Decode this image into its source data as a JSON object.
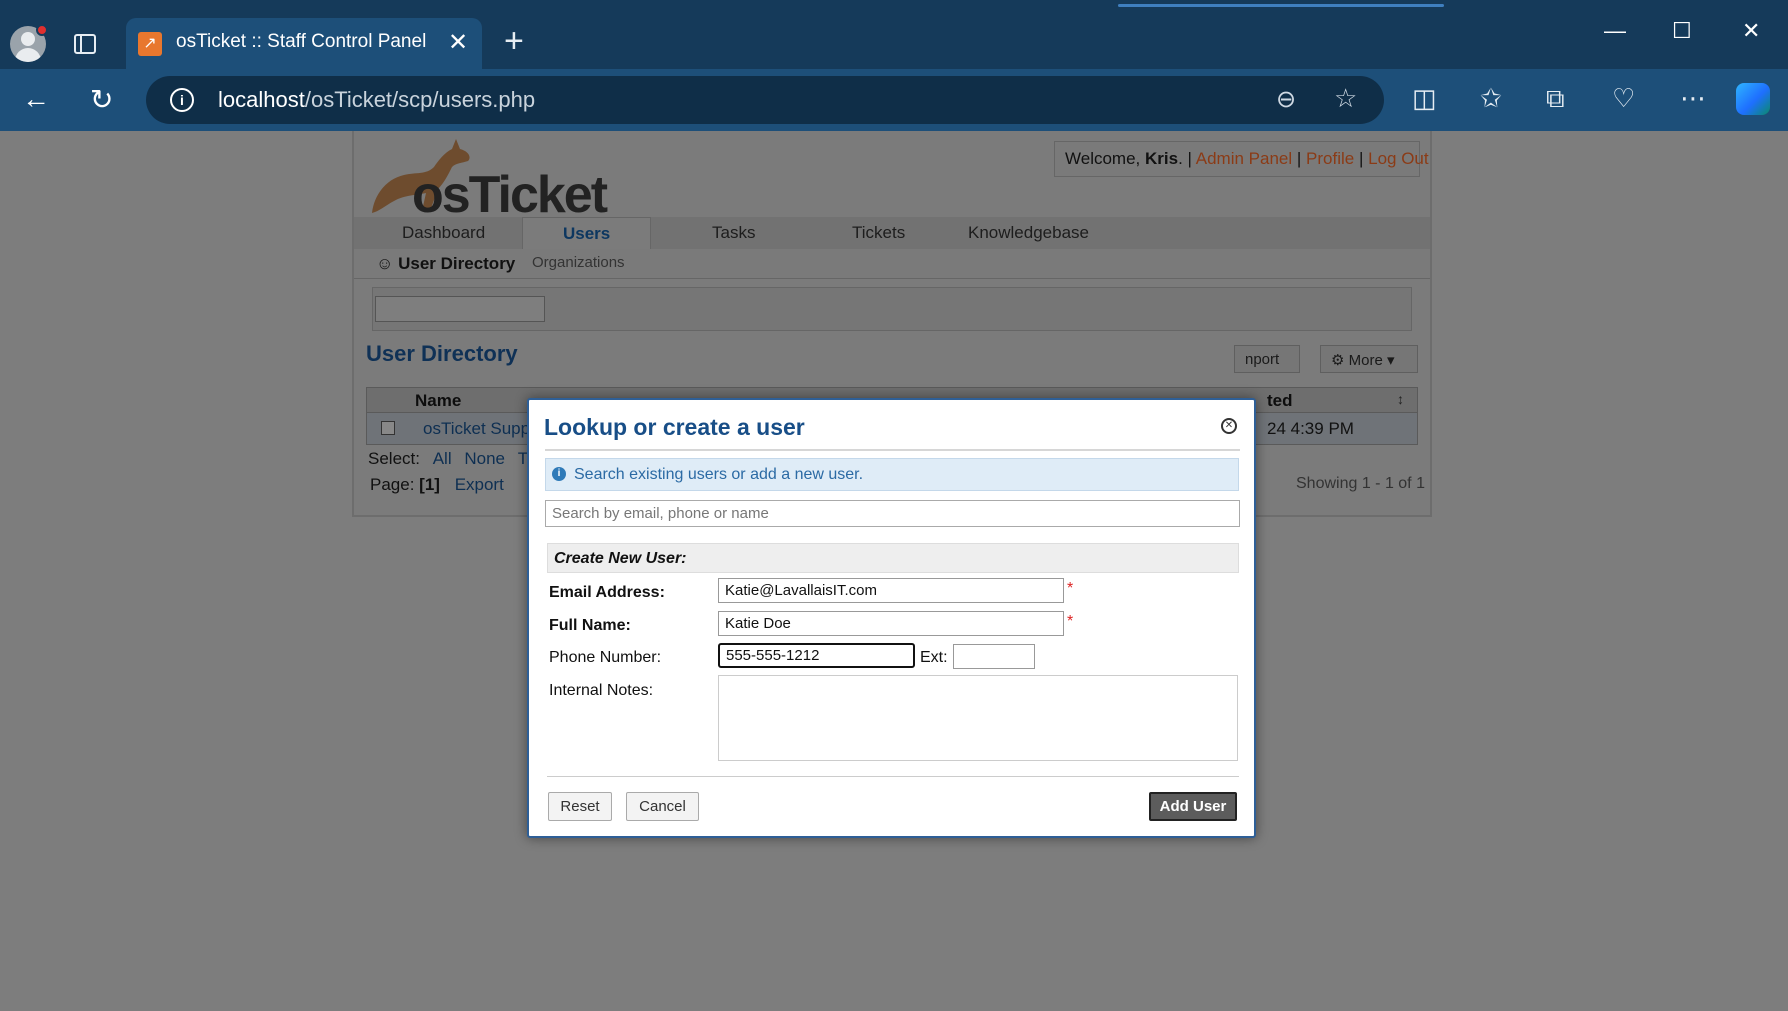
{
  "browser": {
    "tab_title": "osTicket :: Staff Control Panel",
    "url_host": "localhost",
    "url_path": "/osTicket/scp/users.php"
  },
  "header": {
    "welcome_prefix": "Welcome, ",
    "user_name": "Kris",
    "welcome_suffix": ". |",
    "admin_panel": "Admin Panel",
    "profile": "Profile",
    "logout": "Log Out",
    "sep": "|",
    "logo_text": "osTicket"
  },
  "nav": {
    "tabs": [
      "Dashboard",
      "Users",
      "Tasks",
      "Tickets",
      "Knowledgebase"
    ],
    "subnav_user_directory": "User Directory",
    "subnav_organizations": "Organizations"
  },
  "directory": {
    "title": "User Directory",
    "import_label": "nport",
    "more_label": "More",
    "col_name": "Name",
    "col_updated": "ted",
    "row_name": "osTicket Suppo",
    "row_updated": "24 4:39 PM",
    "select_label": "Select:",
    "select_all": "All",
    "select_none": "None",
    "select_toggle": "To",
    "page_label": "Page:",
    "page_current": "[1]",
    "export": "Export",
    "showing": "Showing 1 - 1 of 1"
  },
  "modal": {
    "title": "Lookup or create a user",
    "info_text": "Search existing users or add a new user.",
    "search_placeholder": "Search by email, phone or name",
    "section_title": "Create New User:",
    "email_label": "Email Address:",
    "email_value": "Katie@LavallaisIT.com",
    "name_label": "Full Name:",
    "name_value": "Katie Doe",
    "phone_label": "Phone Number:",
    "phone_value": "555-555-1212",
    "ext_label": "Ext:",
    "ext_value": "",
    "notes_label": "Internal Notes:",
    "required_mark": "*",
    "reset": "Reset",
    "cancel": "Cancel",
    "add_user": "Add User"
  },
  "colors": {
    "chrome": "#153a5a",
    "accent": "#184e87",
    "link": "#8b3b16"
  }
}
